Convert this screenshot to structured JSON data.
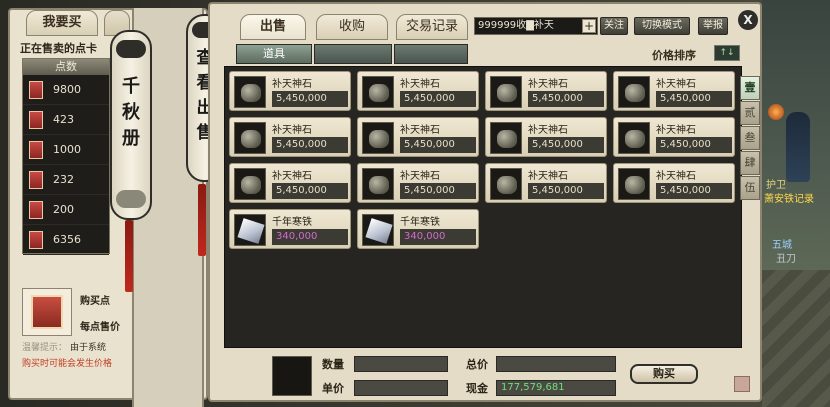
{
  "left_panel": {
    "tab_buy": "我要买",
    "selling_title": "正在售卖的点卡",
    "points_header": "点数",
    "points": [
      "9800",
      "423",
      "1000",
      "232",
      "200",
      "6356"
    ],
    "buy_points_label": "购买点",
    "per_point_label": "每点售价",
    "tip_warm": "温馨提示：",
    "tip_system": "由于系统",
    "tip_warning": "购买时可能会发生价格"
  },
  "scroll_qianqiu": "千秋册",
  "scroll_view": "查看出售",
  "tabs": [
    "出售",
    "收购",
    "交易记录"
  ],
  "search": {
    "value": "999999收▇补天"
  },
  "buttons": {
    "plus": "+",
    "follow": "关注",
    "switch_mode": "切换模式",
    "report": "举报",
    "close": "X",
    "buy": "购买"
  },
  "subtabs": [
    "道具",
    "",
    ""
  ],
  "sort_label": "价格排序",
  "sort_icon_text": "↑↓",
  "items": [
    {
      "name": "补天神石",
      "price": "5,450,000",
      "icon": "stone-icon",
      "color": "normal"
    },
    {
      "name": "补天神石",
      "price": "5,450,000",
      "icon": "stone-icon",
      "color": "normal"
    },
    {
      "name": "补天神石",
      "price": "5,450,000",
      "icon": "stone-icon",
      "color": "normal"
    },
    {
      "name": "补天神石",
      "price": "5,450,000",
      "icon": "stone-icon",
      "color": "normal"
    },
    {
      "name": "补天神石",
      "price": "5,450,000",
      "icon": "stone-icon",
      "color": "normal"
    },
    {
      "name": "补天神石",
      "price": "5,450,000",
      "icon": "stone-icon",
      "color": "normal"
    },
    {
      "name": "补天神石",
      "price": "5,450,000",
      "icon": "stone-icon",
      "color": "normal"
    },
    {
      "name": "补天神石",
      "price": "5,450,000",
      "icon": "stone-icon",
      "color": "normal"
    },
    {
      "name": "补天神石",
      "price": "5,450,000",
      "icon": "stone-icon",
      "color": "normal"
    },
    {
      "name": "补天神石",
      "price": "5,450,000",
      "icon": "stone-icon",
      "color": "normal"
    },
    {
      "name": "补天神石",
      "price": "5,450,000",
      "icon": "stone-icon",
      "color": "normal"
    },
    {
      "name": "补天神石",
      "price": "5,450,000",
      "icon": "stone-icon",
      "color": "normal"
    },
    {
      "name": "千年寒铁",
      "price": "340,000",
      "icon": "iron-icon",
      "color": "pink"
    },
    {
      "name": "千年寒铁",
      "price": "340,000",
      "icon": "iron-icon",
      "color": "pink"
    }
  ],
  "side_tabs": [
    "壹",
    "贰",
    "叁",
    "肆",
    "伍"
  ],
  "footer": {
    "quantity_label": "数量",
    "unit_price_label": "单价",
    "total_label": "总价",
    "cash_label": "现金",
    "cash_value": "177,579,681"
  },
  "scene": {
    "npc_line1": "护卫",
    "npc_line2": "萧安铁记录",
    "npc_line3": "五城",
    "npc_line4": "丑刀"
  },
  "colors": {
    "accent_pink": "#d46ad1",
    "cash_green": "#6fe07a",
    "warning_red": "#c23b22"
  }
}
